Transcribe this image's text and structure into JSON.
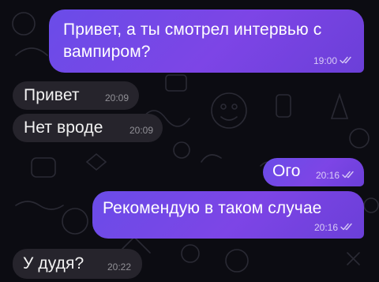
{
  "messages": [
    {
      "text": "Привет, а ты смотрел интервью с вампиром?",
      "time": "19:00",
      "direction": "outgoing",
      "status": "read"
    },
    {
      "text": "Привет",
      "time": "20:09",
      "direction": "incoming"
    },
    {
      "text": "Нет вроде",
      "time": "20:09",
      "direction": "incoming"
    },
    {
      "text": "Ого",
      "time": "20:16",
      "direction": "outgoing",
      "status": "read"
    },
    {
      "text": "Рекомендую в таком случае",
      "time": "20:16",
      "direction": "outgoing",
      "status": "read"
    },
    {
      "text": "У дудя?",
      "time": "20:22",
      "direction": "incoming"
    }
  ],
  "colors": {
    "outgoing_bubble": "#7447e4",
    "incoming_bubble": "#26242c",
    "background": "#0c0c12"
  },
  "icons": {
    "read_status": "double-check-icon",
    "wallpaper": "doodle-pattern"
  }
}
